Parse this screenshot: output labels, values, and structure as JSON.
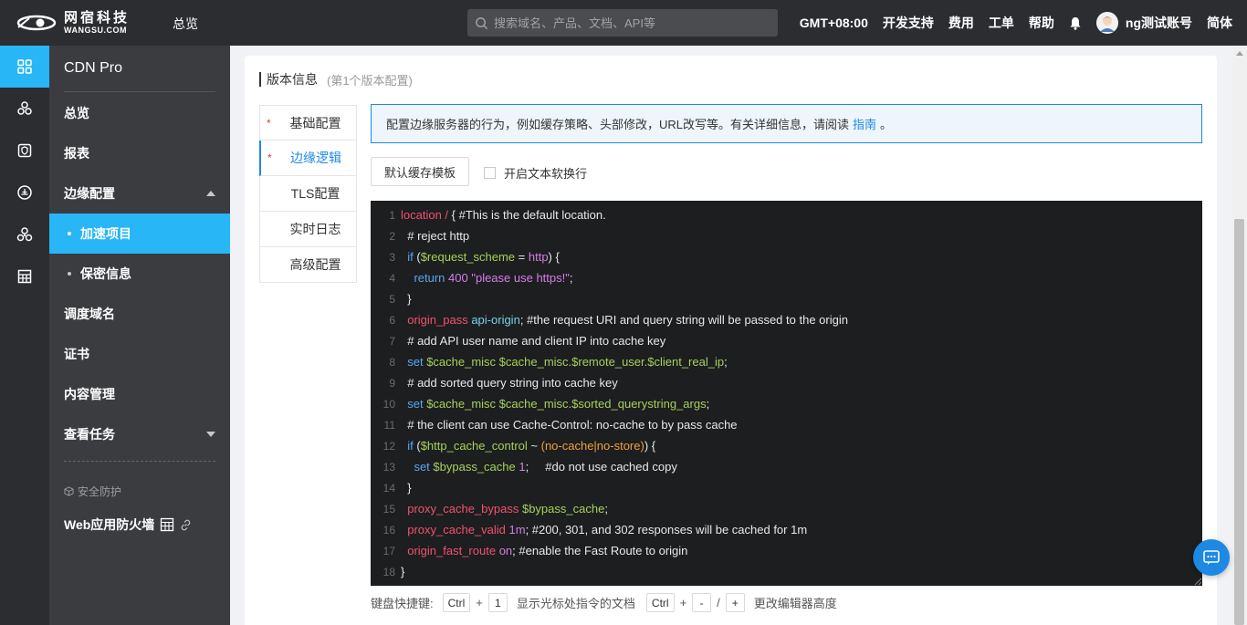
{
  "topbar": {
    "logo_cn": "网宿科技",
    "logo_en": "WANGSU.COM",
    "overview": "总览",
    "search_placeholder": "搜索域名、产品、文档、API等",
    "timezone": "GMT+08:00",
    "dev_support": "开发支持",
    "billing": "费用",
    "tickets": "工单",
    "help": "帮助",
    "username": "ng测试账号",
    "language": "简体"
  },
  "sidebar": {
    "title": "CDN Pro",
    "items": {
      "overview": "总览",
      "reports": "报表",
      "edge_config": "边缘配置",
      "accel_projects": "加速项目",
      "secret_info": "保密信息",
      "dispatch_domain": "调度域名",
      "certificates": "证书",
      "content_mgmt": "内容管理",
      "view_tasks": "查看任务"
    },
    "section_security": "安全防护",
    "waf": "Web应用防火墙"
  },
  "main": {
    "header": "版本信息",
    "header_sub": "(第1个版本配置)",
    "tabs": {
      "basic": "基础配置",
      "edge_logic": "边缘逻辑",
      "tls": "TLS配置",
      "realtime_log": "实时日志",
      "advanced": "高级配置"
    },
    "info_text": "配置边缘服务器的行为，例如缓存策略、头部修改，URL改写等。有关详细信息，请阅读",
    "info_link": "指南",
    "info_end": "。",
    "template_button": "默认缓存模板",
    "soft_wrap_label": "开启文本软换行",
    "shortcuts": {
      "label": "键盘快捷键:",
      "ctrl": "Ctrl",
      "plus": "+",
      "one": "1",
      "doc_text": "显示光标处指令的文档",
      "minus_key": "-",
      "slash": "/",
      "plus_key": "+",
      "height_text": "更改编辑器高度"
    }
  },
  "code_lines": [
    {
      "n": "1",
      "t": [
        [
          "location",
          "k-red"
        ],
        [
          " / ",
          "k-red"
        ],
        [
          "{ #This is the default location.",
          "k-white"
        ]
      ]
    },
    {
      "n": "2",
      "t": [
        [
          "  # reject http",
          "k-white"
        ]
      ]
    },
    {
      "n": "3",
      "t": [
        [
          "  if",
          "k-blue"
        ],
        [
          " (",
          "k-white"
        ],
        [
          "$request_scheme",
          "k-green"
        ],
        [
          " = ",
          "k-white"
        ],
        [
          "http",
          "k-purple"
        ],
        [
          ") {",
          "k-white"
        ]
      ]
    },
    {
      "n": "4",
      "t": [
        [
          "    return",
          "k-blue"
        ],
        [
          " 400 ",
          "k-purple"
        ],
        [
          "\"please use https!\"",
          "k-purple"
        ],
        [
          ";",
          "k-white"
        ]
      ]
    },
    {
      "n": "5",
      "t": [
        [
          "  }",
          "k-white"
        ]
      ]
    },
    {
      "n": "6",
      "t": [
        [
          "  origin_pass",
          "k-red"
        ],
        [
          " api-origin",
          "k-cyan"
        ],
        [
          "; #the request URI and query string will be passed to the origin",
          "k-white"
        ]
      ]
    },
    {
      "n": "7",
      "t": [
        [
          "  # add API user name and client IP into cache key",
          "k-white"
        ]
      ]
    },
    {
      "n": "8",
      "t": [
        [
          "  set",
          "k-blue"
        ],
        [
          " $cache_misc $cache_misc.$remote_user.$client_real_ip",
          "k-green"
        ],
        [
          ";",
          "k-white"
        ]
      ]
    },
    {
      "n": "9",
      "t": [
        [
          "  # add sorted query string into cache key",
          "k-white"
        ]
      ]
    },
    {
      "n": "10",
      "t": [
        [
          "  set",
          "k-blue"
        ],
        [
          " $cache_misc $cache_misc.$sorted_querystring_args",
          "k-green"
        ],
        [
          ";",
          "k-white"
        ]
      ]
    },
    {
      "n": "11",
      "t": [
        [
          "  # the client can use Cache-Control: no-cache to by pass cache",
          "k-white"
        ]
      ]
    },
    {
      "n": "12",
      "t": [
        [
          "  if",
          "k-blue"
        ],
        [
          " (",
          "k-white"
        ],
        [
          "$http_cache_control",
          "k-green"
        ],
        [
          " ~ ",
          "k-white"
        ],
        [
          "(no-cache|no-store)",
          "k-orange"
        ],
        [
          ") {",
          "k-white"
        ]
      ]
    },
    {
      "n": "13",
      "t": [
        [
          "    set",
          "k-blue"
        ],
        [
          " $bypass_cache",
          "k-green"
        ],
        [
          " 1",
          "k-purple"
        ],
        [
          ";     #do not use cached copy",
          "k-white"
        ]
      ]
    },
    {
      "n": "14",
      "t": [
        [
          "  }",
          "k-white"
        ]
      ]
    },
    {
      "n": "15",
      "t": [
        [
          "  proxy_cache_bypass",
          "k-red"
        ],
        [
          " $bypass_cache",
          "k-green"
        ],
        [
          ";",
          "k-white"
        ]
      ]
    },
    {
      "n": "16",
      "t": [
        [
          "  proxy_cache_valid",
          "k-red"
        ],
        [
          " 1m",
          "k-purple"
        ],
        [
          "; #200, 301, and 302 responses will be cached for 1m",
          "k-white"
        ]
      ]
    },
    {
      "n": "17",
      "t": [
        [
          "  origin_fast_route",
          "k-red"
        ],
        [
          " on",
          "k-purple"
        ],
        [
          "; #enable the Fast Route to origin",
          "k-white"
        ]
      ]
    },
    {
      "n": "18",
      "t": [
        [
          "}",
          "k-white"
        ]
      ]
    }
  ],
  "colors": {
    "accent": "#29b6f6",
    "link": "#1e88e5",
    "topbar_bg": "#2b2d31",
    "sidebar_bg": "#3a3c40",
    "editor_bg": "#1d1e20"
  },
  "icons": {
    "rail": [
      "grid-icon",
      "network-icon",
      "shield-icon",
      "monitor-icon",
      "cluster-icon",
      "table-icon"
    ]
  }
}
